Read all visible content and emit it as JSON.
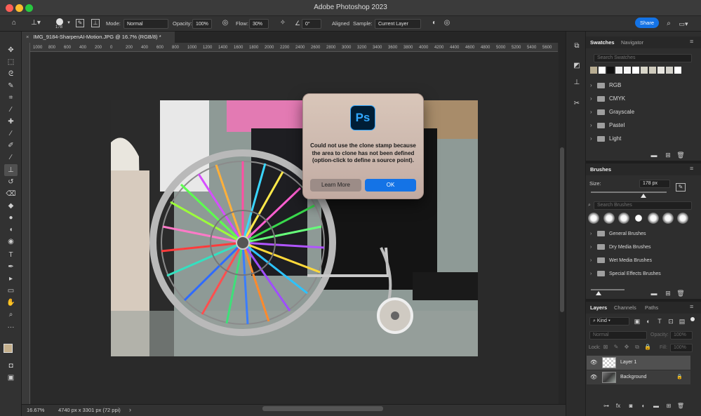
{
  "window": {
    "title": "Adobe Photoshop 2023"
  },
  "options_bar": {
    "brush_size": "178",
    "mode_label": "Mode:",
    "mode_value": "Normal",
    "opacity_label": "Opacity:",
    "opacity_value": "100%",
    "flow_label": "Flow:",
    "flow_value": "30%",
    "angle_value": "0°",
    "aligned_label": "Aligned",
    "sample_label": "Sample:",
    "sample_value": "Current Layer",
    "share_label": "Share"
  },
  "document": {
    "tab_title": "IMG_9184-SharpenAI-Motion.JPG @ 16.7% (RGB/8) *",
    "close_glyph": "×",
    "ruler_ticks": [
      "1000",
      "800",
      "600",
      "400",
      "200",
      "0",
      "200",
      "400",
      "600",
      "800",
      "1000",
      "1200",
      "1400",
      "1600",
      "1800",
      "2000",
      "2200",
      "2400",
      "2600",
      "2800",
      "3000",
      "3200",
      "3400",
      "3600",
      "3800",
      "4000",
      "4200",
      "4400",
      "4600",
      "4800",
      "5000",
      "5200",
      "5400",
      "5600"
    ]
  },
  "status": {
    "zoom": "16.67%",
    "doc_info": "4740 px x 3301 px (72 ppi)",
    "arrow": "›"
  },
  "swatches_panel": {
    "tabs": [
      "Swatches",
      "Navigator"
    ],
    "search_placeholder": "Search Swatches",
    "colors": [
      "#b8ad92",
      "#ffffff",
      "#111111",
      "#f0f0f0",
      "#f6f6f6",
      "#ffffff",
      "#d9d6c9",
      "#cfcbbd",
      "#e8e6e0",
      "#d4d2cb",
      "#ffffff"
    ],
    "groups": [
      "RGB",
      "CMYK",
      "Grayscale",
      "Pastel",
      "Light"
    ]
  },
  "brushes_panel": {
    "tab": "Brushes",
    "size_label": "Size:",
    "size_value": "178 px",
    "search_placeholder": "Search Brushes",
    "groups": [
      "General Brushes",
      "Dry Media Brushes",
      "Wet Media Brushes",
      "Special Effects Brushes"
    ]
  },
  "layers_panel": {
    "tabs": [
      "Layers",
      "Channels",
      "Paths"
    ],
    "kind_label": "Kind",
    "blend_mode": "Normal",
    "opacity_label": "Opacity:",
    "opacity_value": "100%",
    "lock_label": "Lock:",
    "fill_label": "Fill:",
    "fill_value": "100%",
    "layers": [
      "Layer 1",
      "Background"
    ]
  },
  "dialog": {
    "logo_text": "Ps",
    "message": "Could not use the clone stamp because the area to clone has not been defined (option-click to define a source point).",
    "learn_more_label": "Learn More",
    "ok_label": "OK"
  },
  "colors": {
    "accent": "#1473e6",
    "ps_logo_bg": "#001e36",
    "ps_logo_fg": "#31a8ff"
  }
}
